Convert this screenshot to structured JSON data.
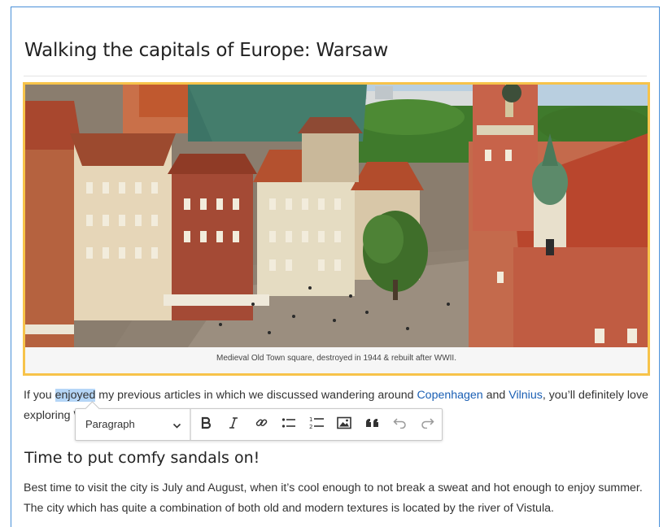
{
  "document": {
    "title": "Walking the capitals of Europe: Warsaw",
    "figure": {
      "caption": "Medieval Old Town square, destroyed in 1944 & rebuilt after WWII."
    },
    "paragraph1": {
      "before": "If you ",
      "selected": "enjoyed",
      "middle": " my previous articles in which we discussed wandering around ",
      "link1": "Copenhagen",
      "and": " and ",
      "link2": "Vilnius",
      "after": ", you’ll definitely love",
      "line2": "exploring W"
    },
    "heading2": "Time to put comfy sandals on!",
    "paragraph2": "Best time to visit the city is July and August, when it’s cool enough to not break a sweat and hot enough to enjoy summer. The city which has quite a combination of both old and modern textures is located by the river of Vistula."
  },
  "toolbar": {
    "heading_value": "Paragraph",
    "buttons": [
      {
        "name": "bold",
        "icon": "bold-icon"
      },
      {
        "name": "italic",
        "icon": "italic-icon"
      },
      {
        "name": "link",
        "icon": "link-icon"
      },
      {
        "name": "bulleted-list",
        "icon": "bulleted-list-icon"
      },
      {
        "name": "numbered-list",
        "icon": "numbered-list-icon"
      },
      {
        "name": "insert-image",
        "icon": "image-icon"
      },
      {
        "name": "block-quote",
        "icon": "quote-icon"
      },
      {
        "name": "undo",
        "icon": "undo-icon"
      },
      {
        "name": "redo",
        "icon": "redo-icon"
      }
    ]
  },
  "colors": {
    "editor_border": "#4a90d9",
    "figure_selected_border": "#f7c34a",
    "selection": "#b5d6f7",
    "link": "#1a5fb4"
  }
}
